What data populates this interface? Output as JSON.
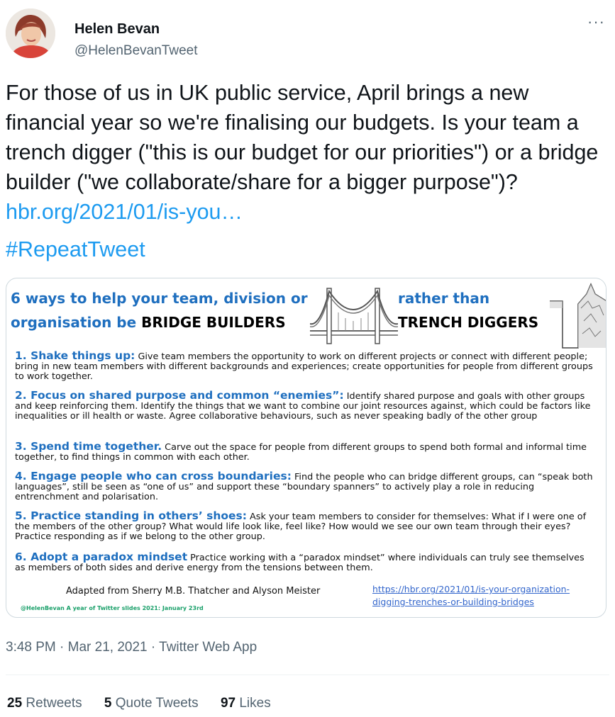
{
  "author": {
    "name": "Helen Bevan",
    "handle": "@HelenBevanTweet",
    "avatar_icon": "profile-photo"
  },
  "tweet": {
    "text": "For those of us in UK public service, April brings a new financial year so we're finalising our budgets. Is your team a trench digger (\"this is our budget for our priorities\") or a bridge builder (\"we collaborate/share for a bigger purpose\")? ",
    "link": "hbr.org/2021/01/is-you…",
    "hashtag": "#RepeatTweet"
  },
  "image": {
    "title_line1": "6 ways to help your team, division or",
    "title_line2_blue": "organisation be ",
    "title_line2_black": "BRIDGE BUILDERS",
    "rather_than": "rather than",
    "trench_diggers": "TRENCH DIGGERS",
    "points": [
      {
        "heading": "1. Shake things up:",
        "body": " Give team members the opportunity to work on different projects or connect with different people; bring in new team members with different backgrounds and experiences; create opportunities for people from different groups to work together."
      },
      {
        "heading": "2. Focus on shared purpose and common “enemies”:",
        "body": " Identify shared purpose and goals with other groups and keep reinforcing them. Identify the things that we want to combine our joint resources against, which could be factors like inequalities or ill health or waste. Agree collaborative behaviours, such as never speaking badly of the other group"
      },
      {
        "heading": "3. Spend time together.",
        "body": " Carve out the space for people from different groups to spend both formal and informal time together, to find things in common with each other."
      },
      {
        "heading": "4. Engage people who can cross boundaries:",
        "body": " Find the people who can bridge different groups, can “speak both languages”, still be seen as “one of us” and support these “boundary spanners” to actively play a role in reducing entrenchment and polarisation."
      },
      {
        "heading": "5. Practice standing in others’ shoes:",
        "body": " Ask your team members to consider for themselves: What if I were one of the members of the other group? What would life look like, feel like? How would we see our own team through their eyes? Practice responding as if we belong to the other group."
      },
      {
        "heading": "6. Adopt a paradox mindset",
        "body": " Practice working with a “paradox mindset” where individuals can truly see themselves as members of both sides and derive energy from the tensions between them."
      }
    ],
    "credit": "Adapted from Sherry M.B. Thatcher and Alyson Meister",
    "small_credit": "@HelenBevan A year of Twitter slides 2021: January 23rd",
    "source_link": "https://hbr.org/2021/01/is-your-organization-digging-trenches-or-building-bridges"
  },
  "meta": {
    "timestamp": "3:48 PM · Mar 21, 2021 · Twitter Web App"
  },
  "stats": {
    "retweets_count": "25",
    "retweets_label": "Retweets",
    "quotes_count": "5",
    "quotes_label": "Quote Tweets",
    "likes_count": "97",
    "likes_label": "Likes"
  },
  "colors": {
    "link": "#1d9bf0",
    "secondary_text": "#536471",
    "image_heading_blue": "#1f6fbf"
  }
}
